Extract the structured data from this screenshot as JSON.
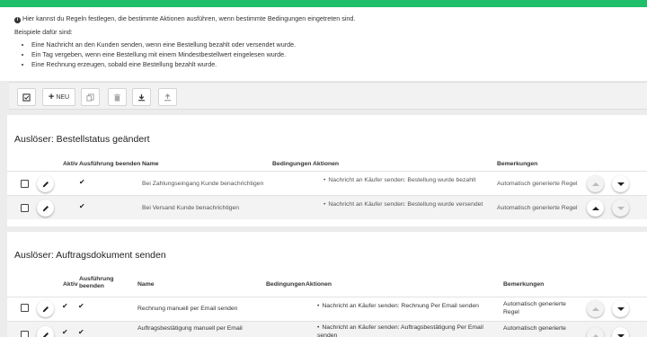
{
  "intro": {
    "text": "Hier kannst du Regeln festlegen, die bestimmte Aktionen ausführen, wenn bestimmte Bedingungen eingetreten sind.",
    "examples_label": "Beispiele dafür sind:",
    "examples": [
      "Eine Nachricht an den Kunden senden, wenn eine Bestellung bezahlt oder versendet wurde.",
      "Ein Tag vergeben, wenn eine Bestellung mit einem Mindestbestellwert eingelesen wurde.",
      "Eine Rechnung erzeugen, sobald eine Bestellung bezahlt wurde."
    ]
  },
  "toolbar": {
    "new_label": "NEU"
  },
  "colors": {
    "accent": "#1fbf6a",
    "page_bg": "#ececec"
  },
  "sections": [
    {
      "title": "Auslöser: Bestellstatus geändert",
      "headers": {
        "active": "Aktiv",
        "execution": "Ausführung beenden",
        "name": "Name",
        "conditions": "Bedingungen",
        "actions": "Aktionen",
        "remarks": "Bemerkungen"
      },
      "rows": [
        {
          "active": "",
          "execution": "✔",
          "name": "Bei Zahlungseingang Kunde benachrichtigen",
          "conditions": "",
          "action": "Nachricht an Käufer senden: Bestellung wurde bezahlt",
          "remark": "Automatisch generierte Regel"
        },
        {
          "active": "",
          "execution": "✔",
          "name": "Bei Versand Kunde benachrichtigen",
          "conditions": "",
          "action": "Nachricht an Käufer senden: Bestellung wurde versendet",
          "remark": "Automatisch generierte Regel"
        }
      ]
    },
    {
      "title": "Auslöser: Auftragsdokument senden",
      "headers": {
        "active": "Aktiv",
        "execution": "Ausführung beenden",
        "name": "Name",
        "conditions": "Bedingungen",
        "actions": "Aktionen",
        "remarks": "Bemerkungen"
      },
      "rows": [
        {
          "active": "✔",
          "execution": "✔",
          "name": "Rechnung manuell per Email senden",
          "conditions": "",
          "action": "Nachricht an Käufer senden: Rechnung Per Email senden",
          "remark": "Automatisch generierte Regel"
        },
        {
          "active": "✔",
          "execution": "✔",
          "name": "Auftragsbestätigung manuell per Email",
          "conditions": "",
          "action": "Nachricht an Käufer senden: Auftragsbestätigung Per Email senden",
          "remark": "Automatisch generierte"
        }
      ]
    }
  ]
}
